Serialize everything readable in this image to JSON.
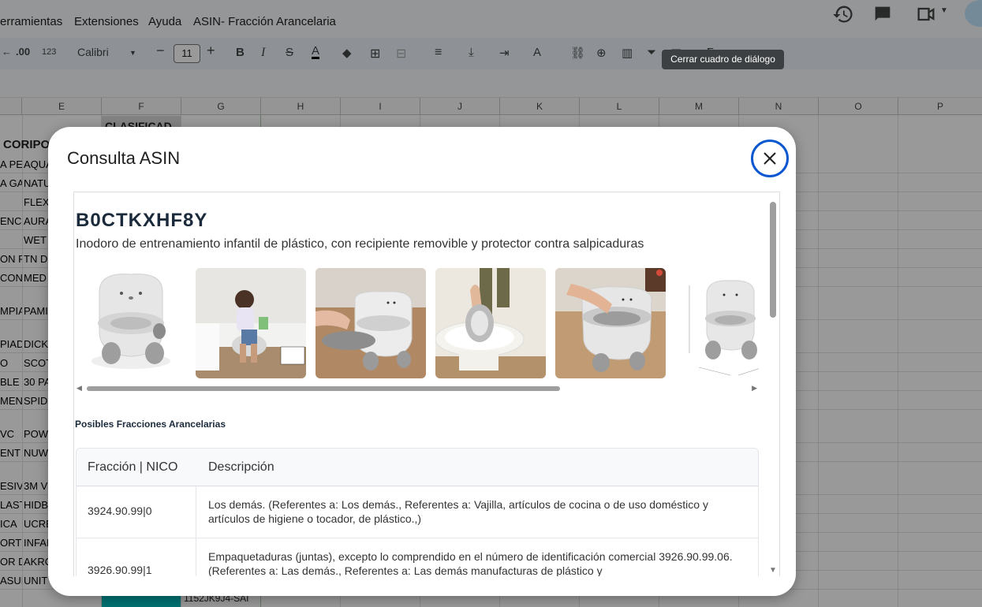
{
  "menubar": {
    "items": [
      "erramientas",
      "Extensiones",
      "Ayuda"
    ],
    "doc_title": "ASIN- Fracción Arancelaria"
  },
  "toolbar": {
    "decimal_label": ".00",
    "format_123": "123",
    "font_name": "Calibri",
    "font_size": "11",
    "sum_symbol": "Σ"
  },
  "columns": [
    "E",
    "F",
    "G",
    "H",
    "I",
    "J",
    "K",
    "L",
    "M",
    "N",
    "O",
    "P"
  ],
  "sheet": {
    "f_header": "CLASIFICAD",
    "bottom_cell": "1152JK9J4-SAI",
    "row_header_a": "CORIPO",
    "rows": [
      {
        "a": "A PE",
        "e": "AQUA"
      },
      {
        "a": "A GA",
        "e": "NATU"
      },
      {
        "a": "",
        "e": "FLEX"
      },
      {
        "a": "ENCI",
        "e": "AURA"
      },
      {
        "a": "",
        "e": "WET"
      },
      {
        "a": "ON P",
        "e": "TN D"
      },
      {
        "a": "CON",
        "e": "MED"
      },
      {
        "a": "MPIA",
        "e": "PAMI"
      },
      {
        "a": "PIAD",
        "e": "DICKI"
      },
      {
        "a": "O",
        "e": "SCOT"
      },
      {
        "a": "BLE S",
        "e": "30 PA"
      },
      {
        "a": "MEN",
        "e": "SPIDE"
      },
      {
        "a": "VC",
        "e": "POW"
      },
      {
        "a": "ENT",
        "e": "NUW"
      },
      {
        "a": "ESIVA",
        "e": "3M V"
      },
      {
        "a": "LAST",
        "e": "HIDB"
      },
      {
        "a": "ICA",
        "e": "UCRE"
      },
      {
        "a": "ORT",
        "e": "INFAI"
      },
      {
        "a": "OR D",
        "e": "AKRO"
      },
      {
        "a": "ASUR",
        "e": "UNIT"
      }
    ]
  },
  "dialog": {
    "title": "Consulta ASIN",
    "close_tooltip": "Cerrar cuadro de diálogo",
    "asin": "B0CTKXHF8Y",
    "product_description": "Inodoro de entrenamiento infantil de plástico, con recipiente removible y protector contra salpicaduras",
    "section_title": "Posibles Fracciones Arancelarias",
    "table": {
      "headers": [
        "Fracción | NICO",
        "Descripción"
      ],
      "rows": [
        {
          "code": "3924.90.99|0",
          "description": "Los demás. (Referentes a: Los demás., Referentes a: Vajilla, artículos de cocina o de uso doméstico y artículos de higiene o tocador, de plástico.,)"
        },
        {
          "code": "3926.90.99|1",
          "description": "Empaquetaduras (juntas), excepto lo comprendido en el número de identificación comercial 3926.90.99.06. (Referentes a: Las demás., Referentes a: Las demás manufacturas de plástico y"
        }
      ]
    }
  },
  "colors": {
    "accent": "#0b57d0",
    "teal_cell": "#00bfbf"
  }
}
